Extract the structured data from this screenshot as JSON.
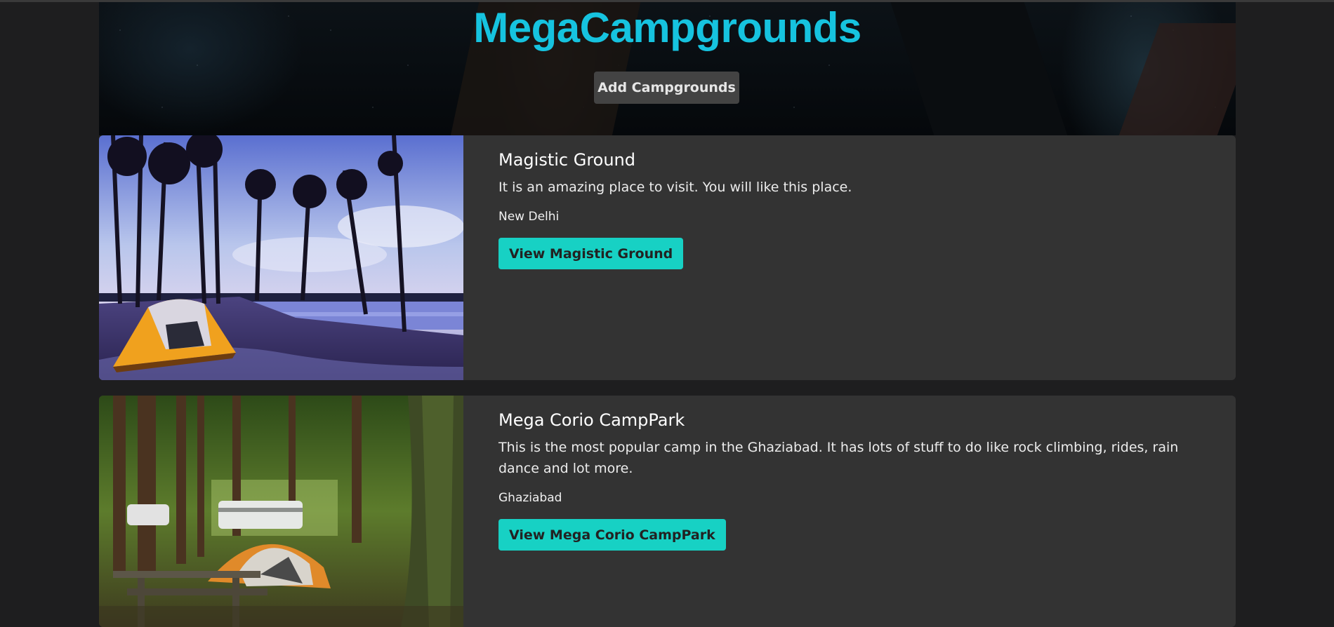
{
  "brand": {
    "title": "MegaCampgrounds"
  },
  "hero": {
    "add_button_label": "Add Campgrounds"
  },
  "campgrounds": [
    {
      "title": "Magistic Ground",
      "description": "It is an amazing place to visit. You will like this place.",
      "location": "New Delhi",
      "button_label": "View Magistic Ground"
    },
    {
      "title": "Mega Corio CampPark",
      "description": "This is the most popular camp in the Ghaziabad. It has lots of stuff to do like rock climbing, rides, rain dance and lot more.",
      "location": "Ghaziabad",
      "button_label": "View Mega Corio CampPark"
    }
  ],
  "colors": {
    "brand": "#16c3df",
    "view_button": "#17d1c4",
    "card_background": "#333333",
    "page_background": "#1e1e1f"
  }
}
